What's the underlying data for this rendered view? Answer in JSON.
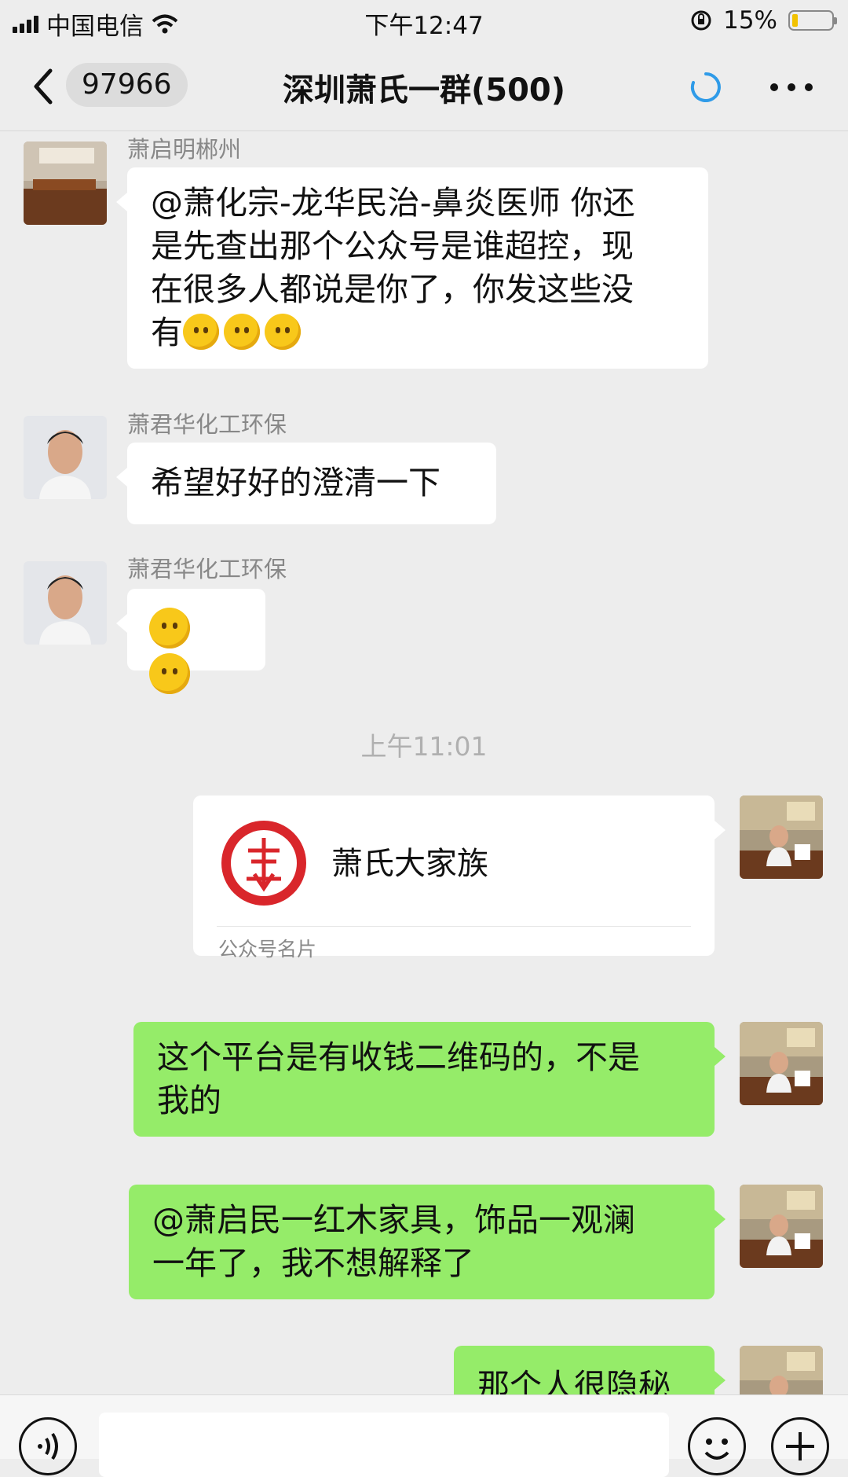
{
  "status_bar": {
    "carrier": "中国电信",
    "time": "下午12:47",
    "battery_percent": "15%",
    "battery_level": 0.15
  },
  "nav": {
    "unread_count": "97966",
    "title": "深圳萧氏一群(500)"
  },
  "messages": [
    {
      "sender": "萧启明郴州",
      "lines": [
        "@萧化宗-龙华民治-鼻炎医师 你还",
        "是先查出那个公众号是谁超控，现",
        "在很多人都说是你了，你发这些没"
      ],
      "last_line": "有",
      "emojis": [
        "thinking-face",
        "thinking-face",
        "thinking-face"
      ]
    },
    {
      "sender": "萧君华化工环保",
      "text": "希望好好的澄清一下"
    },
    {
      "sender": "萧君华化工环保",
      "emojis": [
        "grinning-face",
        "smirking-face"
      ]
    }
  ],
  "time_separator": "上午11:01",
  "card": {
    "name": "萧氏大家族",
    "footer": "公众号名片"
  },
  "outgoing": [
    {
      "lines": [
        "这个平台是有收钱二维码的，不是",
        "我的"
      ]
    },
    {
      "lines": [
        "@萧启民一红木家具，饰品一观澜",
        "一年了，我不想解释了"
      ]
    },
    {
      "lines": [
        "那个人很隐秘"
      ]
    }
  ],
  "colors": {
    "background": "#ededed",
    "outgoing_bubble": "#95ec69",
    "incoming_bubble": "#ffffff",
    "accent_loading": "#2f9be8"
  }
}
